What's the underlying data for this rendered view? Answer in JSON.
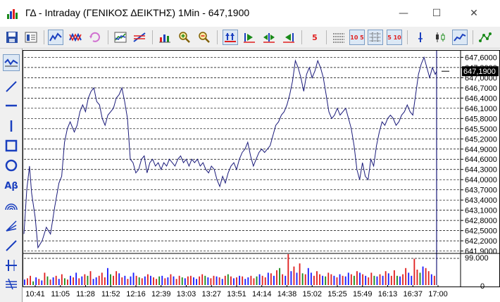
{
  "window": {
    "title": "ΓΔ - Intraday (ΓΕΝΙΚΟΣ ΔΕΙΚΤΗΣ) 1Min - 647,1900",
    "minimize_glyph": "—",
    "maximize_glyph": "☐",
    "close_glyph": "✕"
  },
  "toolbar": {
    "icons": [
      "save-icon",
      "template-icon",
      "line-chart-icon",
      "bar-compare-icon",
      "refresh-icon",
      "indicator-icon",
      "trend-icon",
      "volume-icon",
      "zoom-in-icon",
      "zoom-out-icon",
      "scroll-start-icon",
      "step-back-icon",
      "step-center-icon",
      "step-forward-icon",
      "period-5-icon",
      "hlines-icon",
      "grid-10-5-icon",
      "grid-icon",
      "grid-5-10-icon",
      "crosshair-icon",
      "candles-icon",
      "line-mode-icon",
      "pattern-icon"
    ],
    "labels": {
      "p5": "5",
      "p10_5": "10 5",
      "p5_10": "5 10"
    }
  },
  "leftbar": {
    "tools": [
      "indicator-tool-icon",
      "trendline-tool-icon",
      "hline-tool-icon",
      "vline-tool-icon",
      "rectangle-tool-icon",
      "ellipse-tool-icon",
      "text-tool-icon",
      "arc-tool-icon",
      "fan-tool-icon",
      "line-tool-icon",
      "cross-tool-icon",
      "channel-tool-icon"
    ],
    "text_tool_label": "Aβ"
  },
  "chart_data": {
    "type": "line",
    "current_value_label": "647,1900",
    "y_ticks": [
      "647,6000",
      "647,3000",
      "647,0000",
      "646,7000",
      "646,4000",
      "646,1000",
      "645,8000",
      "645,5000",
      "645,2000",
      "644,9000",
      "644,6000",
      "644,3000",
      "644,0000",
      "643,7000",
      "643,4000",
      "643,1000",
      "642,8000",
      "642,5000",
      "642,2000",
      "641,9000"
    ],
    "ylim": [
      641.85,
      647.65
    ],
    "x_ticks": [
      "10:41",
      "11:05",
      "11:28",
      "11:52",
      "12:16",
      "12:39",
      "13:03",
      "13:27",
      "13:51",
      "14:14",
      "14:38",
      "15:02",
      "15:25",
      "15:49",
      "16:13",
      "16:37",
      "17:00"
    ],
    "volume_axis": {
      "max_label": "99.000",
      "min_label": "0"
    },
    "colors": {
      "price_line": "#1a1a7a",
      "grid": "#000000",
      "vol_up": "#1a1aff",
      "vol_down": "#e02020",
      "vol_neutral": "#1a8a1a",
      "vline": "#1a1a7a"
    },
    "price_series": [
      {
        "t": 0,
        "y": 642.4
      },
      {
        "t": 4,
        "y": 643.7
      },
      {
        "t": 8,
        "y": 644.4
      },
      {
        "t": 11,
        "y": 643.6
      },
      {
        "t": 16,
        "y": 642.9
      },
      {
        "t": 20,
        "y": 642.0
      },
      {
        "t": 26,
        "y": 642.2
      },
      {
        "t": 32,
        "y": 642.6
      },
      {
        "t": 38,
        "y": 642.4
      },
      {
        "t": 44,
        "y": 643.2
      },
      {
        "t": 50,
        "y": 643.9
      },
      {
        "t": 54,
        "y": 644.1
      },
      {
        "t": 58,
        "y": 645.1
      },
      {
        "t": 62,
        "y": 645.5
      },
      {
        "t": 66,
        "y": 645.7
      },
      {
        "t": 72,
        "y": 645.4
      },
      {
        "t": 76,
        "y": 645.6
      },
      {
        "t": 80,
        "y": 646.0
      },
      {
        "t": 84,
        "y": 646.2
      },
      {
        "t": 88,
        "y": 646.0
      },
      {
        "t": 92,
        "y": 646.4
      },
      {
        "t": 96,
        "y": 646.6
      },
      {
        "t": 100,
        "y": 646.7
      },
      {
        "t": 104,
        "y": 646.3
      },
      {
        "t": 108,
        "y": 646.2
      },
      {
        "t": 112,
        "y": 645.8
      },
      {
        "t": 116,
        "y": 645.6
      },
      {
        "t": 120,
        "y": 645.9
      },
      {
        "t": 124,
        "y": 646.0
      },
      {
        "t": 128,
        "y": 646.1
      },
      {
        "t": 132,
        "y": 646.4
      },
      {
        "t": 136,
        "y": 646.5
      },
      {
        "t": 140,
        "y": 646.7
      },
      {
        "t": 144,
        "y": 646.3
      },
      {
        "t": 148,
        "y": 645.8
      },
      {
        "t": 152,
        "y": 644.6
      },
      {
        "t": 156,
        "y": 644.5
      },
      {
        "t": 160,
        "y": 644.2
      },
      {
        "t": 164,
        "y": 644.3
      },
      {
        "t": 168,
        "y": 644.6
      },
      {
        "t": 172,
        "y": 644.7
      },
      {
        "t": 176,
        "y": 644.2
      },
      {
        "t": 180,
        "y": 644.5
      },
      {
        "t": 184,
        "y": 644.6
      },
      {
        "t": 188,
        "y": 644.4
      },
      {
        "t": 192,
        "y": 644.5
      },
      {
        "t": 196,
        "y": 644.3
      },
      {
        "t": 200,
        "y": 644.5
      },
      {
        "t": 204,
        "y": 644.4
      },
      {
        "t": 208,
        "y": 644.6
      },
      {
        "t": 212,
        "y": 644.5
      },
      {
        "t": 216,
        "y": 644.4
      },
      {
        "t": 220,
        "y": 644.6
      },
      {
        "t": 224,
        "y": 644.7
      },
      {
        "t": 228,
        "y": 644.5
      },
      {
        "t": 232,
        "y": 644.6
      },
      {
        "t": 236,
        "y": 644.4
      },
      {
        "t": 240,
        "y": 644.6
      },
      {
        "t": 244,
        "y": 644.5
      },
      {
        "t": 248,
        "y": 644.6
      },
      {
        "t": 252,
        "y": 644.4
      },
      {
        "t": 256,
        "y": 644.5
      },
      {
        "t": 260,
        "y": 644.3
      },
      {
        "t": 264,
        "y": 644.2
      },
      {
        "t": 268,
        "y": 644.4
      },
      {
        "t": 272,
        "y": 644.3
      },
      {
        "t": 276,
        "y": 644.0
      },
      {
        "t": 280,
        "y": 643.8
      },
      {
        "t": 284,
        "y": 644.1
      },
      {
        "t": 288,
        "y": 643.9
      },
      {
        "t": 292,
        "y": 644.2
      },
      {
        "t": 296,
        "y": 644.4
      },
      {
        "t": 300,
        "y": 644.5
      },
      {
        "t": 304,
        "y": 644.3
      },
      {
        "t": 308,
        "y": 644.6
      },
      {
        "t": 312,
        "y": 644.8
      },
      {
        "t": 316,
        "y": 644.9
      },
      {
        "t": 320,
        "y": 645.1
      },
      {
        "t": 324,
        "y": 644.7
      },
      {
        "t": 328,
        "y": 644.4
      },
      {
        "t": 332,
        "y": 644.6
      },
      {
        "t": 336,
        "y": 644.8
      },
      {
        "t": 340,
        "y": 644.9
      },
      {
        "t": 344,
        "y": 644.8
      },
      {
        "t": 348,
        "y": 644.9
      },
      {
        "t": 352,
        "y": 645.0
      },
      {
        "t": 356,
        "y": 645.3
      },
      {
        "t": 360,
        "y": 645.6
      },
      {
        "t": 364,
        "y": 645.7
      },
      {
        "t": 368,
        "y": 645.9
      },
      {
        "t": 372,
        "y": 646.0
      },
      {
        "t": 376,
        "y": 646.2
      },
      {
        "t": 380,
        "y": 646.5
      },
      {
        "t": 384,
        "y": 646.9
      },
      {
        "t": 388,
        "y": 647.5
      },
      {
        "t": 392,
        "y": 647.3
      },
      {
        "t": 396,
        "y": 647.0
      },
      {
        "t": 400,
        "y": 646.6
      },
      {
        "t": 404,
        "y": 647.1
      },
      {
        "t": 408,
        "y": 647.3
      },
      {
        "t": 412,
        "y": 647.0
      },
      {
        "t": 416,
        "y": 647.2
      },
      {
        "t": 420,
        "y": 647.5
      },
      {
        "t": 424,
        "y": 647.3
      },
      {
        "t": 428,
        "y": 647.0
      },
      {
        "t": 432,
        "y": 646.5
      },
      {
        "t": 436,
        "y": 646.0
      },
      {
        "t": 440,
        "y": 645.8
      },
      {
        "t": 444,
        "y": 645.9
      },
      {
        "t": 448,
        "y": 646.1
      },
      {
        "t": 452,
        "y": 645.9
      },
      {
        "t": 456,
        "y": 646.0
      },
      {
        "t": 460,
        "y": 646.1
      },
      {
        "t": 464,
        "y": 645.8
      },
      {
        "t": 468,
        "y": 645.5
      },
      {
        "t": 472,
        "y": 645.0
      },
      {
        "t": 476,
        "y": 644.3
      },
      {
        "t": 480,
        "y": 644.0
      },
      {
        "t": 484,
        "y": 644.5
      },
      {
        "t": 488,
        "y": 644.1
      },
      {
        "t": 492,
        "y": 644.0
      },
      {
        "t": 496,
        "y": 644.6
      },
      {
        "t": 500,
        "y": 644.4
      },
      {
        "t": 504,
        "y": 645.0
      },
      {
        "t": 508,
        "y": 645.4
      },
      {
        "t": 512,
        "y": 645.7
      },
      {
        "t": 516,
        "y": 645.6
      },
      {
        "t": 520,
        "y": 645.8
      },
      {
        "t": 524,
        "y": 645.9
      },
      {
        "t": 528,
        "y": 645.8
      },
      {
        "t": 532,
        "y": 645.6
      },
      {
        "t": 536,
        "y": 645.7
      },
      {
        "t": 540,
        "y": 645.9
      },
      {
        "t": 544,
        "y": 646.0
      },
      {
        "t": 548,
        "y": 646.2
      },
      {
        "t": 552,
        "y": 646.0
      },
      {
        "t": 556,
        "y": 645.9
      },
      {
        "t": 560,
        "y": 646.5
      },
      {
        "t": 564,
        "y": 647.1
      },
      {
        "t": 568,
        "y": 647.4
      },
      {
        "t": 572,
        "y": 647.6
      },
      {
        "t": 576,
        "y": 647.3
      },
      {
        "t": 580,
        "y": 647.0
      },
      {
        "t": 584,
        "y": 647.3
      },
      {
        "t": 588,
        "y": 647.1
      },
      {
        "t": 590,
        "y": 647.19
      }
    ],
    "volume_series": [
      18,
      22,
      30,
      12,
      25,
      20,
      15,
      40,
      28,
      18,
      25,
      30,
      20,
      35,
      22,
      18,
      30,
      25,
      40,
      22,
      28,
      35,
      30,
      45,
      20,
      25,
      30,
      40,
      25,
      55,
      35,
      30,
      45,
      38,
      25,
      30,
      20,
      28,
      40,
      30,
      25,
      22,
      28,
      35,
      30,
      25,
      20,
      28,
      30,
      22,
      25,
      35,
      28,
      20,
      30,
      25,
      22,
      28,
      30,
      25,
      20,
      28,
      35,
      30,
      25,
      22,
      30,
      28,
      25,
      20,
      30,
      35,
      28,
      22,
      25,
      30,
      28,
      20,
      25,
      30,
      22,
      28,
      35,
      30,
      25,
      40,
      38,
      30,
      48,
      55,
      35,
      30,
      100,
      45,
      60,
      40,
      70,
      38,
      35,
      55,
      40,
      30,
      45,
      35,
      30,
      28,
      40,
      35,
      30,
      25,
      35,
      30,
      28,
      40,
      35,
      30,
      45,
      40,
      35,
      30,
      25,
      40,
      30,
      28,
      35,
      30,
      45,
      38,
      30,
      48,
      30,
      28,
      35,
      55,
      40,
      30,
      85,
      50,
      40,
      60,
      55,
      45,
      35,
      30
    ],
    "volume_colors": "urdgudurgdurudgrudurudgruudrdugrduruduurgdurudrgudurudrgudruudrgudrudurgduruduurdgudrurudgrudurudgruudrdugrduruduurgdurudrgudurudrgudruudrgudrudurgduruduurdgudrurudgrudurudgr"
  }
}
